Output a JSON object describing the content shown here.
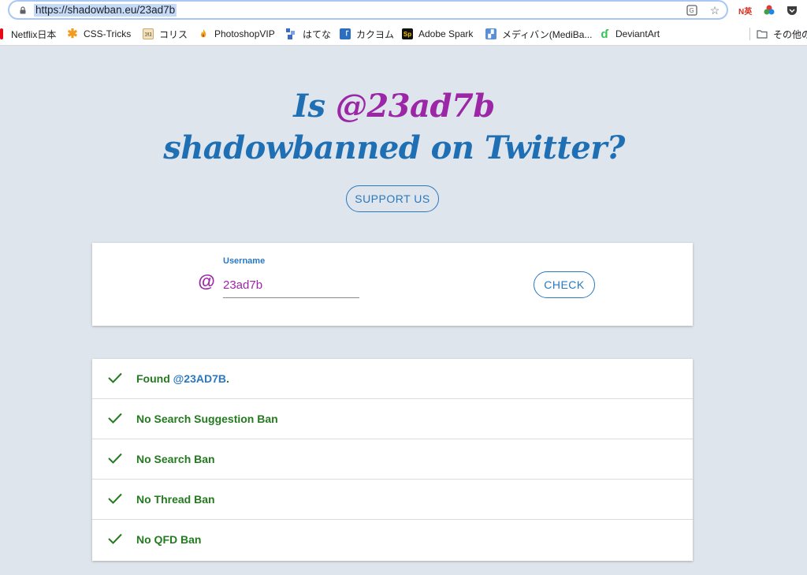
{
  "browser": {
    "url": "https://shadowban.eu/23ad7b",
    "extensions": [
      "translate-icon",
      "star-icon",
      "N英",
      "color-circles-icon",
      "pocket-icon"
    ],
    "bookmarks": [
      {
        "label": "Netflix日本",
        "icon": "netflix-icon",
        "color": "#e50914"
      },
      {
        "label": "CSS-Tricks",
        "icon": "asterisk-icon",
        "color": "#f29c1f"
      },
      {
        "label": "コリス",
        "icon": "coliss-icon",
        "color": "#c9a86a"
      },
      {
        "label": "PhotoshopVIP",
        "icon": "flame-icon",
        "color": "#f1a31b"
      },
      {
        "label": "はてな",
        "icon": "hatena-icon",
        "color": "#3b6cc9"
      },
      {
        "label": "カクヨム",
        "icon": "kakuyomu-icon",
        "color": "#2a6fc1"
      },
      {
        "label": "Adobe Spark",
        "icon": "spark-icon",
        "color": "#111111"
      },
      {
        "label": "メディバン(MediBa...",
        "icon": "medibang-icon",
        "color": "#5b8fd6"
      },
      {
        "label": "DeviantArt",
        "icon": "deviantart-icon",
        "color": "#35c453"
      },
      {
        "label": "その他の",
        "icon": "folder-icon",
        "color": "#777777"
      }
    ]
  },
  "page": {
    "title_prefix": "Is ",
    "title_handle": "@23ad7b",
    "title_line2": "shadowbanned on Twitter?",
    "support_label": "SUPPORT US"
  },
  "search": {
    "at_symbol": "@",
    "label": "Username",
    "value": "23ad7b",
    "button_label": "CHECK"
  },
  "results": {
    "found_prefix": "Found ",
    "found_user": "@23AD7B",
    "found_suffix": ".",
    "items": [
      "No Search Suggestion Ban",
      "No Search Ban",
      "No Thread Ban",
      "No QFD Ban"
    ]
  },
  "colors": {
    "title_blue": "#1f6fb5",
    "handle_purple": "#9b27a6",
    "success_green": "#237a1f",
    "background": "#dfe5ec"
  }
}
